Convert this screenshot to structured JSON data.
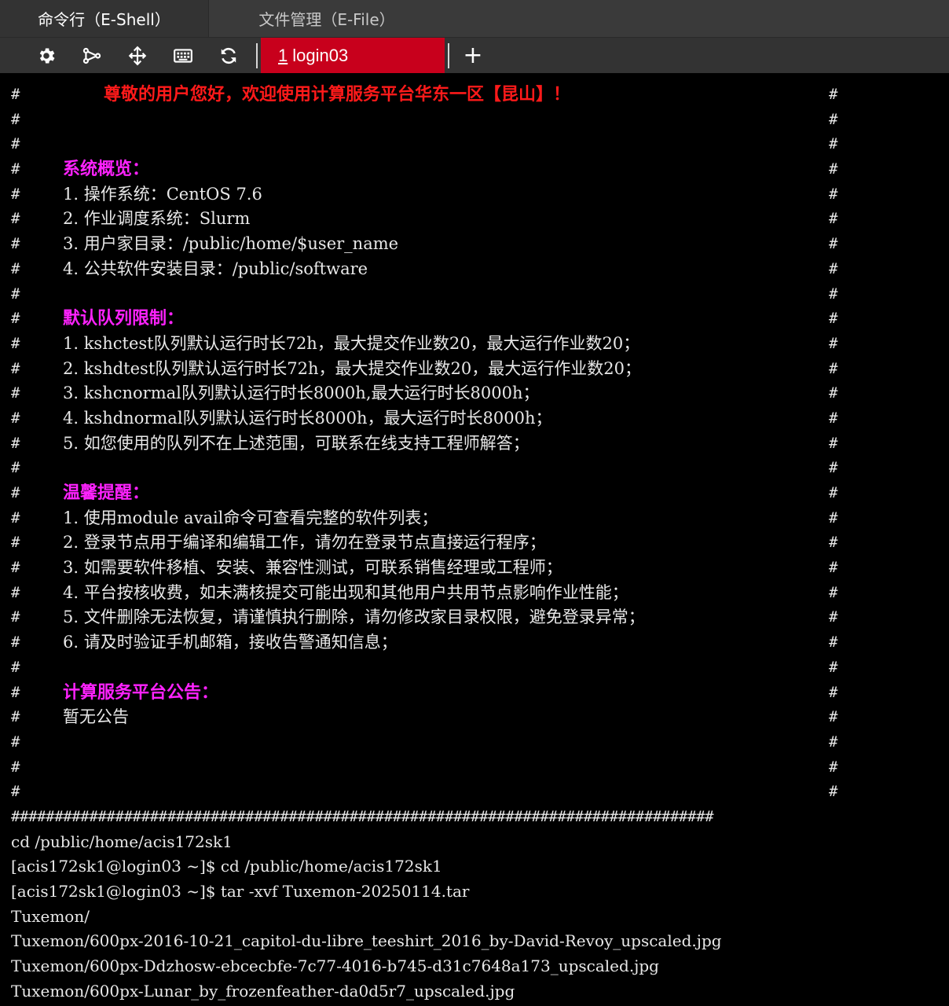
{
  "mode_tabs": {
    "shell": "命令行（E-Shell）",
    "file": "文件管理（E-File）"
  },
  "toolbar": {
    "icons": [
      "gear-icon",
      "branch-icon",
      "transfer-icon",
      "keyboard-icon",
      "refresh-icon"
    ],
    "session_tab_number": "1",
    "session_tab_label": "login03",
    "add_tab_label": "+"
  },
  "colors": {
    "accent_red": "#c8001c",
    "welcome_red": "#ff1a1a",
    "heading_magenta": "#ff22ff",
    "terminal_bg": "#000000",
    "terminal_fg": "#e8e8e8"
  },
  "terminal": {
    "hash": "#",
    "welcome": "尊敬的用户您好，欢迎使用计算服务平台华东一区【昆山】！",
    "sections": {
      "overview_title": "系统概览：",
      "overview_1": "1. 操作系统：CentOS 7.6",
      "overview_2": "2. 作业调度系统：Slurm",
      "overview_3": "3. 用户家目录：/public/home/$user_name",
      "overview_4": "4. 公共软件安装目录：/public/software",
      "queue_title": "默认队列限制：",
      "queue_1": "1. kshctest队列默认运行时长72h，最大提交作业数20，最大运行作业数20；",
      "queue_2": "2. kshdtest队列默认运行时长72h，最大提交作业数20，最大运行作业数20；",
      "queue_3": "3. kshcnormal队列默认运行时长8000h,最大运行时长8000h；",
      "queue_4": "4. kshdnormal队列默认运行时长8000h，最大运行时长8000h；",
      "queue_5": "5. 如您使用的队列不在上述范围，可联系在线支持工程师解答；",
      "tips_title": "温馨提醒：",
      "tips_1": "1. 使用module avail命令可查看完整的软件列表；",
      "tips_2": "2. 登录节点用于编译和编辑工作，请勿在登录节点直接运行程序；",
      "tips_3": "3. 如需要软件移植、安装、兼容性测试，可联系销售经理或工程师；",
      "tips_4": "4. 平台按核收费，如未满核提交可能出现和其他用户共用节点影响作业性能；",
      "tips_5": "5. 文件删除无法恢复，请谨慎执行删除，请勿修改家目录权限，避免登录异常；",
      "tips_6": "6. 请及时验证手机邮箱，接收告警通知信息；",
      "notice_title": "计算服务平台公告：",
      "notice_body": "暂无公告"
    },
    "border": "#################################################################################",
    "output": [
      "cd /public/home/acis172sk1",
      "[acis172sk1@login03 ~]$ cd /public/home/acis172sk1",
      "[acis172sk1@login03 ~]$ tar -xvf Tuxemon-20250114.tar",
      "Tuxemon/",
      "Tuxemon/600px-2016-10-21_capitol-du-libre_teeshirt_2016_by-David-Revoy_upscaled.jpg",
      "Tuxemon/600px-Ddzhosw-ebcecbfe-7c77-4016-b745-d31c7648a173_upscaled.jpg",
      "Tuxemon/600px-Lunar_by_frozenfeather-da0d5r7_upscaled.jpg"
    ]
  }
}
